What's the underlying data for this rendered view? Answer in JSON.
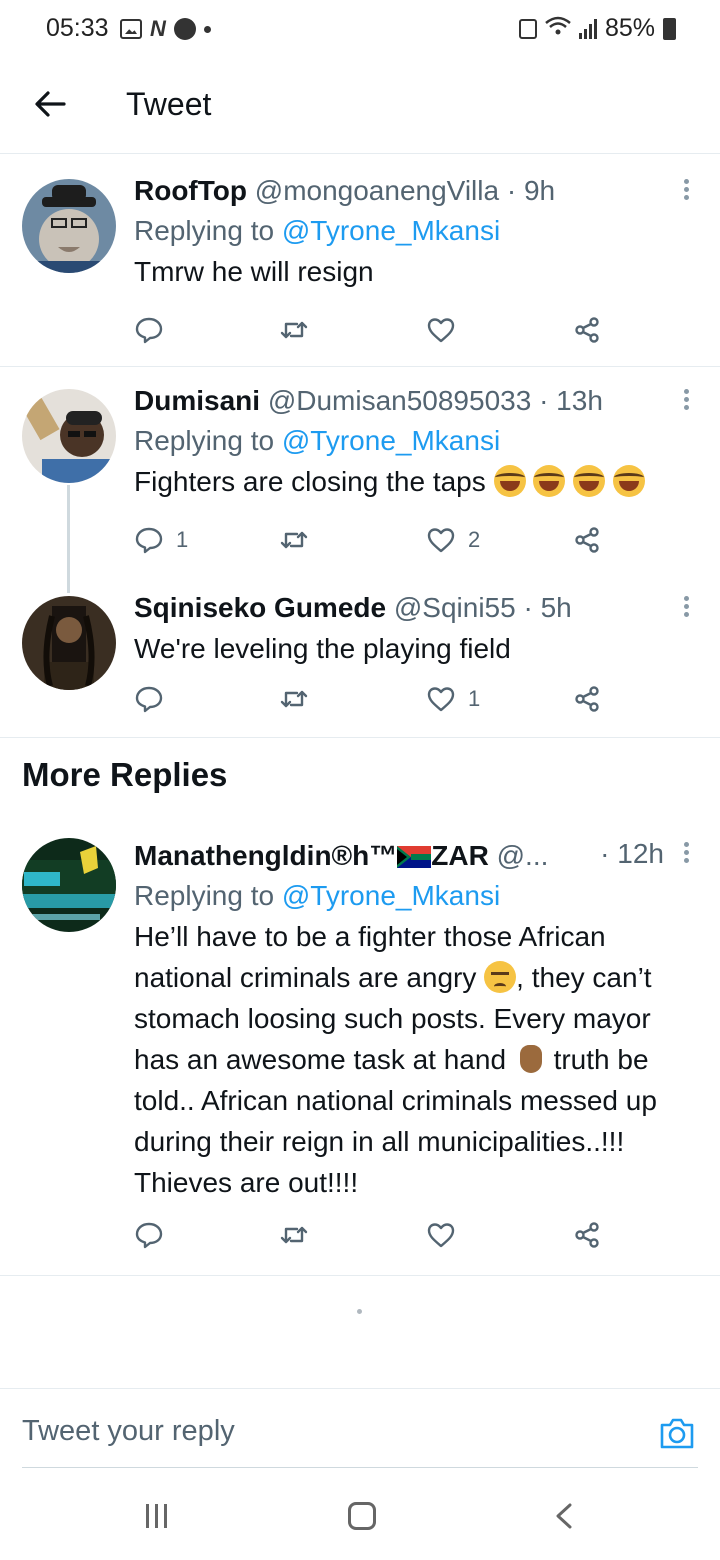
{
  "status_bar": {
    "time": "05:33",
    "battery": "85%"
  },
  "header": {
    "title": "Tweet"
  },
  "tweets": [
    {
      "name": "RoofTop",
      "handle": "@mongoanengVilla · 9h",
      "replying_prefix": "Replying to ",
      "replying_to": "@Tyrone_Mkansi",
      "text": "Tmrw he will resign",
      "replies": "",
      "likes": ""
    },
    {
      "name": "Dumisani",
      "handle": "@Dumisan50895033 · 13h",
      "replying_prefix": "Replying to ",
      "replying_to": "@Tyrone_Mkansi",
      "text": "Fighters are closing the taps ",
      "replies": "1",
      "likes": "2"
    },
    {
      "name": "Sqiniseko Gumede",
      "handle": "@Sqini55 · 5h",
      "text": "We're leveling the playing field",
      "replies": "",
      "likes": "1"
    }
  ],
  "more_replies_label": "More Replies",
  "more_reply": {
    "name": "Manathengldin®h™",
    "name_suffix": "ZAR",
    "handle": "@...",
    "time": "· 12h",
    "replying_prefix": "Replying to ",
    "replying_to": "@Tyrone_Mkansi",
    "text_1": "He’ll have to be a fighter those African national criminals are angry ",
    "text_2": ", they can’t stomach loosing such posts. Every mayor has an awesome task at hand ",
    "text_3": " truth be told.. African national criminals messed up during their reign in all municipalities..!!! Thieves are out!!!!"
  },
  "reply_bar": {
    "placeholder": "Tweet your reply"
  },
  "colors": {
    "link": "#1d9bf0",
    "secondary": "#536471",
    "divider": "#e6ecf0"
  },
  "icons": [
    "back-arrow-icon",
    "more-icon",
    "reply-icon",
    "retweet-icon",
    "like-icon",
    "share-icon",
    "camera-icon"
  ]
}
